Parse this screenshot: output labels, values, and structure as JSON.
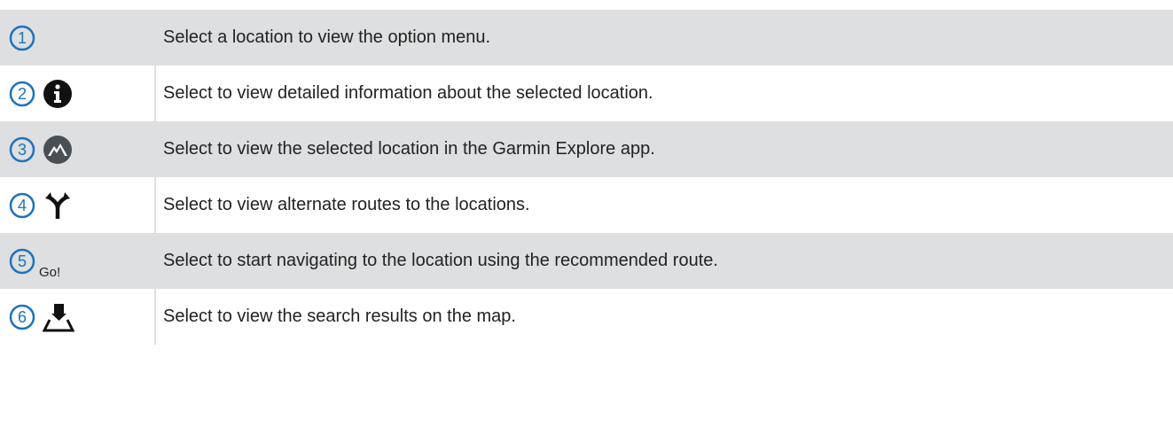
{
  "colors": {
    "accent_blue": "#1e73be",
    "row_shade": "#dedfe0",
    "icon_dark": "#111111"
  },
  "rows": [
    {
      "number": "1",
      "icon": "none",
      "description": "Select a location to view the option menu."
    },
    {
      "number": "2",
      "icon": "info-icon",
      "description": "Select to view detailed information about the selected location."
    },
    {
      "number": "3",
      "icon": "garmin-explore-mountain-icon",
      "description": "Select to view the selected location in the Garmin Explore app."
    },
    {
      "number": "4",
      "icon": "route-fork-icon",
      "description": "Select to view alternate routes to the locations."
    },
    {
      "number": "5",
      "icon_text": "Go!",
      "description": "Select to start navigating to the location using the recommended route."
    },
    {
      "number": "6",
      "icon": "map-results-icon",
      "description": "Select to view the search results on the map."
    }
  ]
}
